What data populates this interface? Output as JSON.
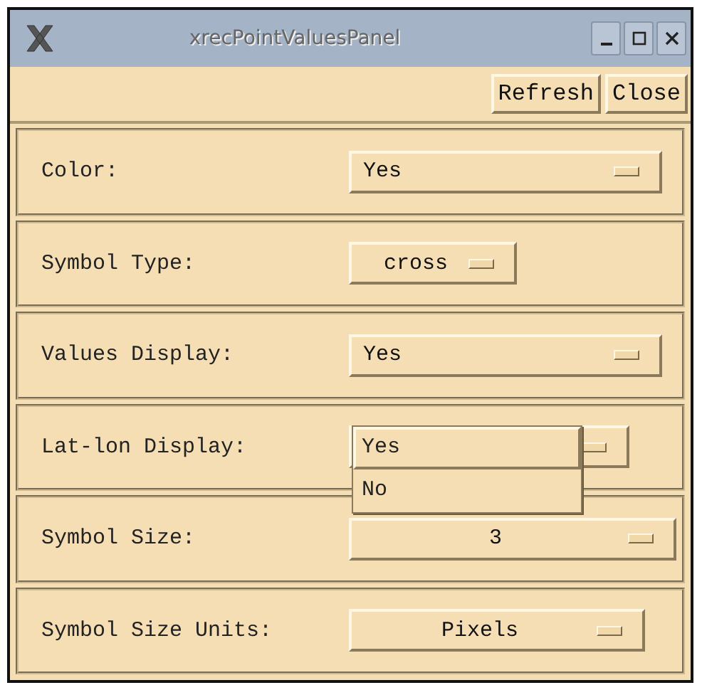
{
  "window": {
    "title": "xrecPointValuesPanel"
  },
  "buttons": [
    "Refresh",
    "Close"
  ],
  "settings": [
    {
      "label": "Color:",
      "value": "Yes",
      "kind": "left",
      "open": false
    },
    {
      "label": "Symbol Type:",
      "value": "cross",
      "kind": "centered",
      "open": false
    },
    {
      "label": "Values Display:",
      "value": "Yes",
      "kind": "left",
      "open": false
    },
    {
      "label": "Lat-lon Display:",
      "kind": "left",
      "open": true,
      "options": [
        {
          "label": "Yes",
          "selected": true
        },
        {
          "label": "No",
          "selected": false
        }
      ]
    },
    {
      "label": "Symbol Size:",
      "value": "3",
      "kind": "centered",
      "open": false
    },
    {
      "label": "Symbol Size Units:",
      "value": "Pixels",
      "kind": "centered",
      "open": false
    }
  ]
}
